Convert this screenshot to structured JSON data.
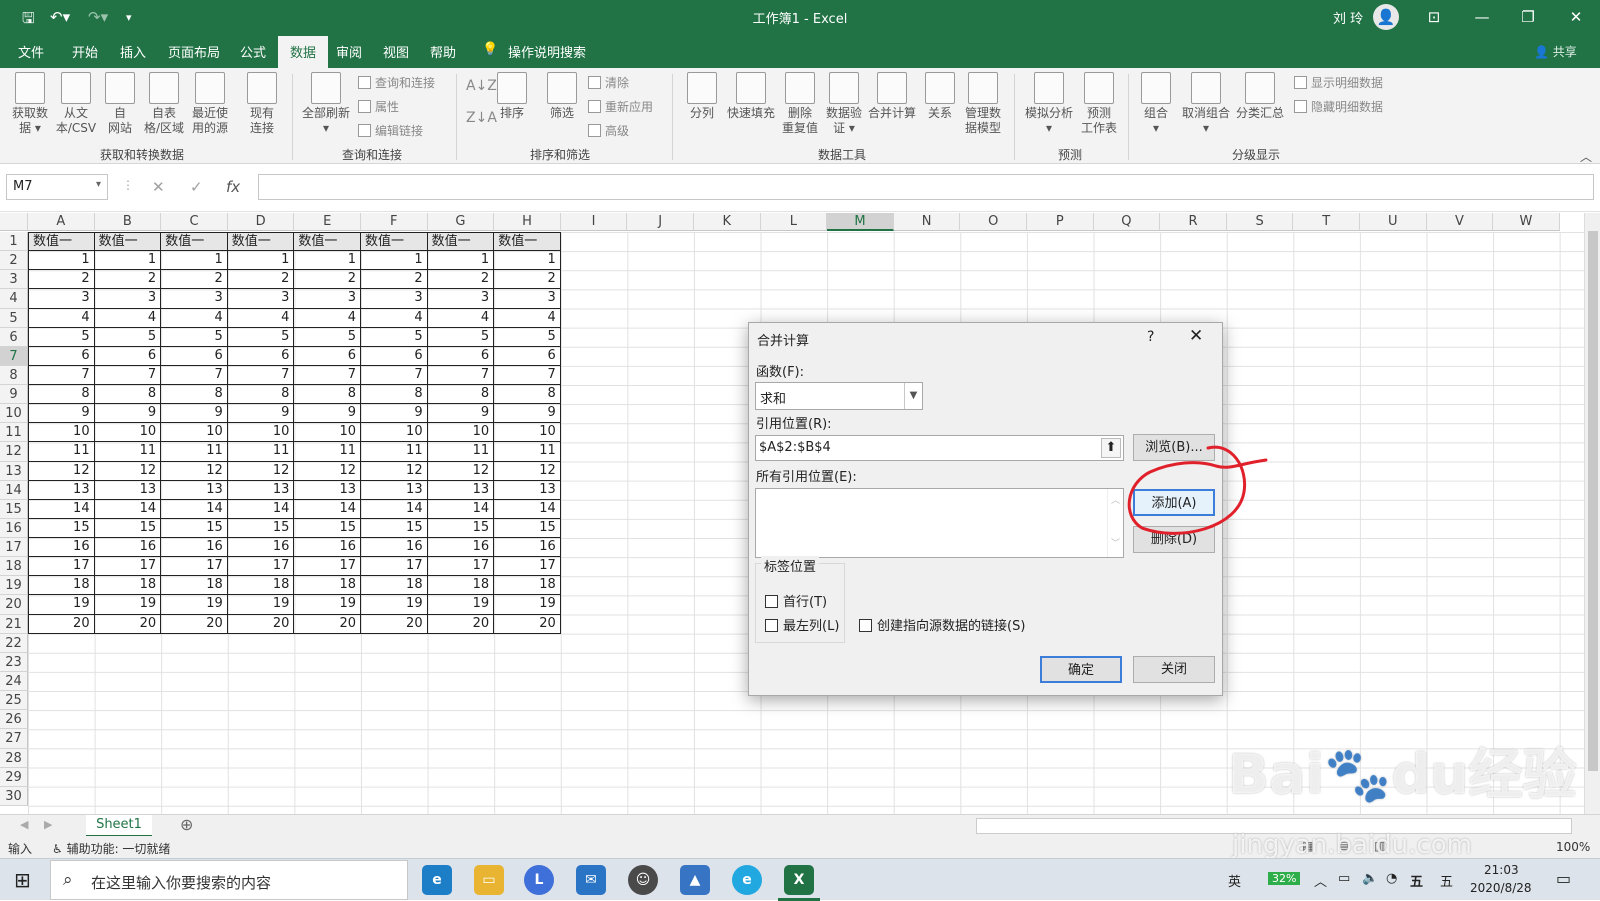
{
  "titlebar": {
    "title": "工作簿1  -  Excel",
    "user": "刘 玲"
  },
  "menu": [
    "文件",
    "开始",
    "插入",
    "页面布局",
    "公式",
    "数据",
    "审阅",
    "视图",
    "帮助"
  ],
  "menu_active_index": 5,
  "tell_me": "操作说明搜索",
  "share": "共享",
  "ribbon": {
    "buttons": [
      {
        "label": "获取数\n据 ▾"
      },
      {
        "label": "从文\n本/CSV"
      },
      {
        "label": "自\n网站"
      },
      {
        "label": "自表\n格/区域"
      },
      {
        "label": "最近使\n用的源"
      },
      {
        "label": "现有\n连接"
      },
      {
        "label": "全部刷新\n▾"
      },
      {
        "label": "排序"
      },
      {
        "label": "筛选"
      },
      {
        "label": "分列"
      },
      {
        "label": "快速填充"
      },
      {
        "label": "删除\n重复值"
      },
      {
        "label": "数据验\n证 ▾"
      },
      {
        "label": "合并计算"
      },
      {
        "label": "关系"
      },
      {
        "label": "管理数\n据模型"
      },
      {
        "label": "模拟分析\n▾"
      },
      {
        "label": "预测\n工作表"
      },
      {
        "label": "组合\n▾"
      },
      {
        "label": "取消组合\n▾"
      },
      {
        "label": "分类汇总"
      }
    ],
    "small": [
      "查询和连接",
      "属性",
      "编辑链接",
      "清除",
      "重新应用",
      "高级",
      "显示明细数据",
      "隐藏明细数据"
    ],
    "groups": [
      "获取和转换数据",
      "查询和连接",
      "排序和筛选",
      "数据工具",
      "预测",
      "分级显示"
    ]
  },
  "formula": {
    "namebox": "M7",
    "content": ""
  },
  "columns": [
    "A",
    "B",
    "C",
    "D",
    "E",
    "F",
    "G",
    "H",
    "I",
    "J",
    "K",
    "L",
    "M",
    "N",
    "O",
    "P",
    "Q",
    "R",
    "S",
    "T",
    "U",
    "V",
    "W"
  ],
  "selected_column": "M",
  "selected_row": 7,
  "rows": [
    "1",
    "2",
    "3",
    "4",
    "5",
    "6",
    "7",
    "8",
    "9",
    "10",
    "11",
    "12",
    "13",
    "14",
    "15",
    "16",
    "17",
    "18",
    "19",
    "20",
    "21",
    "22",
    "23",
    "24",
    "25",
    "26",
    "27",
    "28",
    "29",
    "30"
  ],
  "table": {
    "header": [
      "数值一",
      "数值一",
      "数值一",
      "数值一",
      "数值一",
      "数值一",
      "数值一",
      "数值一"
    ],
    "values": [
      1,
      2,
      3,
      4,
      5,
      6,
      7,
      8,
      9,
      10,
      11,
      12,
      13,
      14,
      15,
      16,
      17,
      18,
      19,
      20
    ]
  },
  "sheet_tab": "Sheet1",
  "status": {
    "mode": "输入",
    "accessibility": "辅助功能: 一切就绪",
    "zoom": "100%"
  },
  "dialog": {
    "title": "合并计算",
    "function_label": "函数(F):",
    "function_value": "求和",
    "ref_label": "引用位置(R):",
    "ref_value": "$A$2:$B$4",
    "browse": "浏览(B)...",
    "all_refs_label": "所有引用位置(E):",
    "add": "添加(A)",
    "delete": "删除(D)",
    "label_group": "标签位置",
    "top_row": "首行(T)",
    "left_col": "最左列(L)",
    "link": "创建指向源数据的链接(S)",
    "ok": "确定",
    "close": "关闭"
  },
  "taskbar": {
    "search_placeholder": "在这里输入你要搜索的内容",
    "battery": "32%",
    "ime1": "英",
    "ime2": "五",
    "ime3": "五",
    "time": "21:03",
    "date": "2020/8/28"
  },
  "colors": {
    "excel_green": "#217346",
    "annotation_red": "#e0202a"
  }
}
